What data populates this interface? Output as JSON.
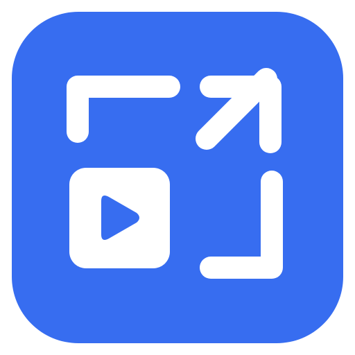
{
  "app_icon": {
    "name": "video-expand-icon",
    "background_color": "#376DF0",
    "glyph_color": "#FFFFFF"
  }
}
